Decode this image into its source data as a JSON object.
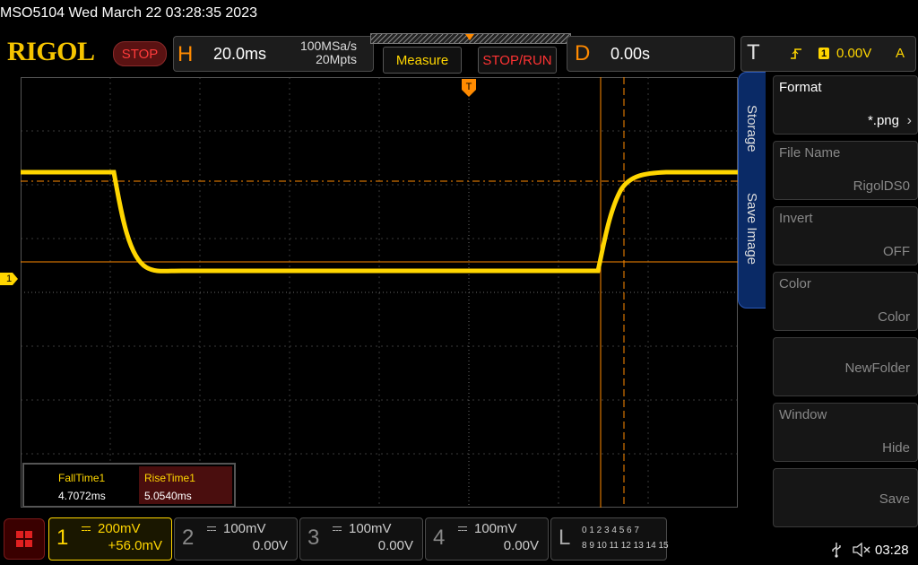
{
  "header": {
    "model_datetime": "MSO5104  Wed March 22 03:28:35 2023",
    "brand": "RIGOL",
    "run_state": "STOP"
  },
  "horizontal": {
    "letter": "H",
    "timebase": "20.0ms",
    "sample_rate": "100MSa/s",
    "memory_depth": "20Mpts"
  },
  "buttons": {
    "measure": "Measure",
    "stop_run": "STOP/RUN"
  },
  "delay": {
    "letter": "D",
    "value": "0.00s"
  },
  "trigger": {
    "letter": "T",
    "channel": "1",
    "level": "0.00V",
    "mode": "A"
  },
  "measurements": {
    "items": [
      {
        "label": "FallTime1",
        "value": "4.7072ms"
      },
      {
        "label": "RiseTime1",
        "value": "5.0540ms"
      }
    ]
  },
  "side_menu": {
    "tabs": [
      "Storage",
      "Save Image"
    ],
    "items": [
      {
        "label": "Format",
        "value": "*.png"
      },
      {
        "label": "File Name",
        "value": "RigolDS0"
      },
      {
        "label": "Invert",
        "value": "OFF"
      },
      {
        "label": "Color",
        "value": "Color"
      },
      {
        "label": "",
        "value": "NewFolder"
      },
      {
        "label": "Window",
        "value": "Hide"
      },
      {
        "label": "",
        "value": "Save"
      }
    ]
  },
  "channels": [
    {
      "num": "1",
      "scale": "200mV",
      "offset": "+56.0mV",
      "active": true,
      "color": "#ffd600"
    },
    {
      "num": "2",
      "scale": "100mV",
      "offset": "0.00V",
      "active": false,
      "color": "#aaaaaa"
    },
    {
      "num": "3",
      "scale": "100mV",
      "offset": "0.00V",
      "active": false,
      "color": "#aaaaaa"
    },
    {
      "num": "4",
      "scale": "100mV",
      "offset": "0.00V",
      "active": false,
      "color": "#aaaaaa"
    }
  ],
  "logic": {
    "letter": "L",
    "row1": "0 1 2 3   4 5 6 7",
    "row2": "8 9 10 11 12 13 14 15"
  },
  "status_bar": {
    "time": "03:28"
  },
  "channel_marker": "1",
  "colors": {
    "trace": "#ffd600",
    "accent": "#ff8a00",
    "stop": "#ff3333"
  }
}
